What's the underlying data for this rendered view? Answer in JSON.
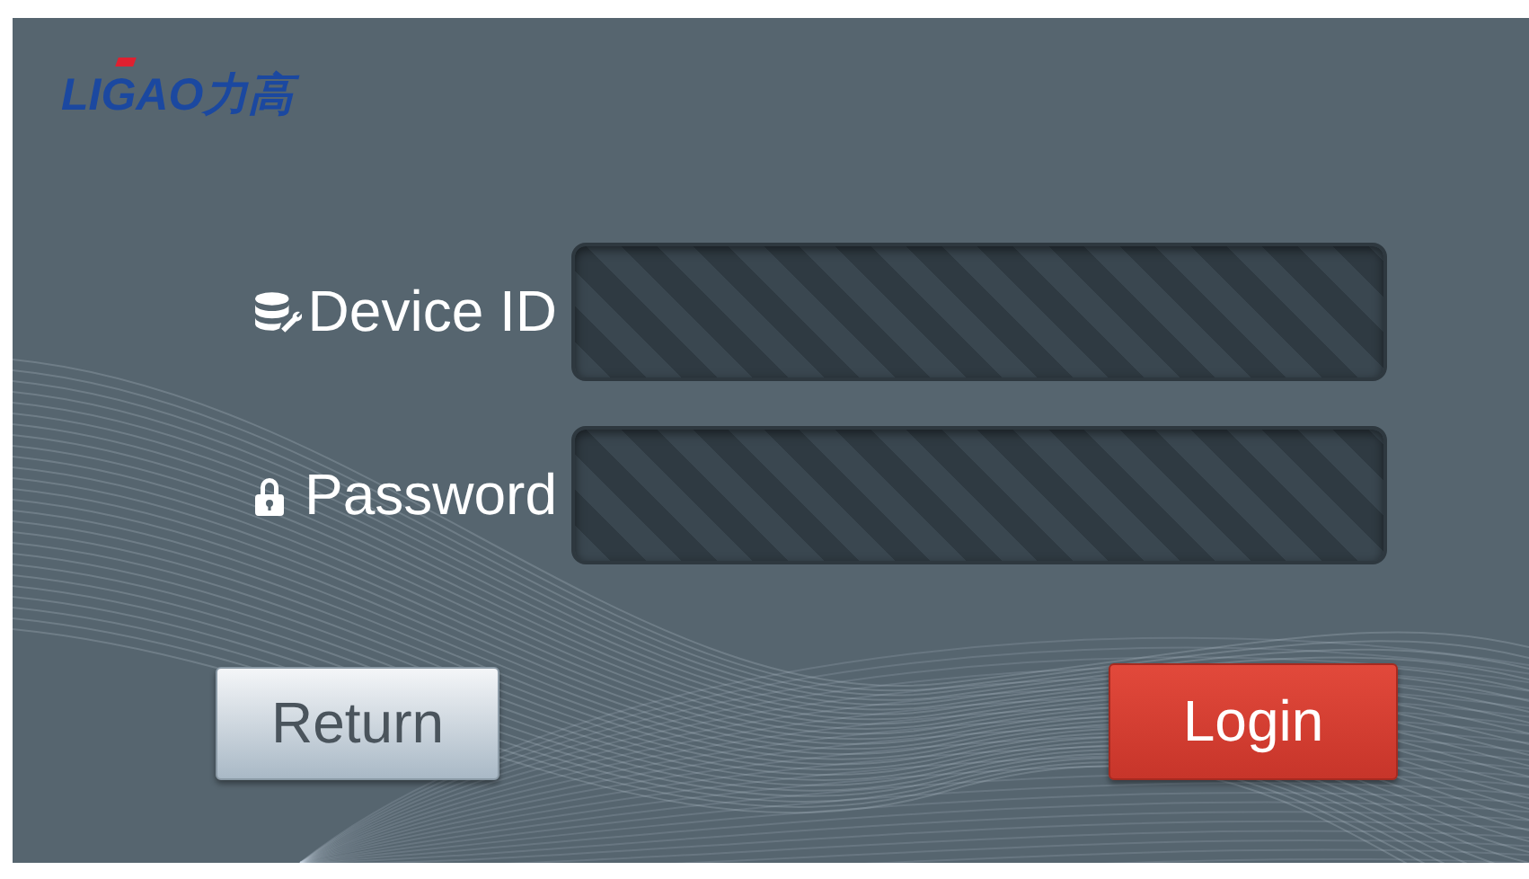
{
  "logo": {
    "text": "LIGAO力高"
  },
  "fields": [
    {
      "label": "Device ID",
      "kind": "database"
    },
    {
      "label": "Password",
      "kind": "lock"
    }
  ],
  "buttons": [
    {
      "label": "Return",
      "kind": "secondary"
    },
    {
      "label": "Login",
      "kind": "primary"
    }
  ]
}
